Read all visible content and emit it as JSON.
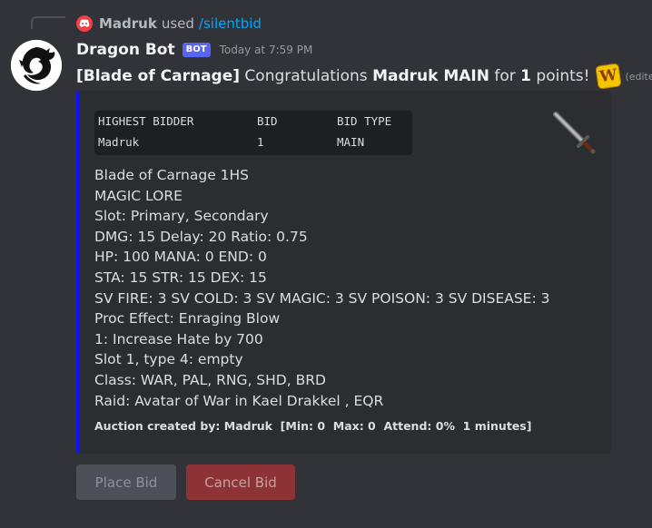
{
  "reply": {
    "username": "Madruk",
    "used_text": "used",
    "command": "/silentbid"
  },
  "message": {
    "bot_name": "Dragon Bot",
    "bot_badge": "BOT",
    "timestamp": "Today at 7:59 PM",
    "item_bracket": "[Blade of Carnage]",
    "congrats_text": "Congratulations",
    "winner": "Madruk MAIN",
    "for_text": "for",
    "points": "1",
    "points_text": "points!",
    "emoji_label": "W",
    "edited": "(edited)"
  },
  "embed": {
    "accent_color": "#1212ff",
    "table": {
      "headers": [
        "HIGHEST BIDDER",
        "BID",
        "BID TYPE"
      ],
      "rows": [
        [
          "Madruk",
          "1",
          "MAIN"
        ]
      ]
    },
    "thumbnail_icon": "sword-icon",
    "details": [
      "Blade of Carnage 1HS",
      "MAGIC LORE",
      "Slot: Primary, Secondary",
      "DMG: 15 Delay: 20 Ratio: 0.75",
      "HP: 100 MANA: 0 END: 0",
      "STA: 15 STR: 15 DEX: 15",
      "SV FIRE: 3 SV COLD: 3 SV MAGIC: 3 SV POISON: 3 SV DISEASE: 3",
      "Proc Effect: Enraging Blow",
      "1: Increase Hate by 700",
      "Slot 1, type 4: empty",
      "Class: WAR, PAL, RNG, SHD, BRD",
      "Raid: Avatar of War in Kael Drakkel , EQR"
    ],
    "footer": "Auction created by: Madruk  [Min: 0  Max: 0  Attend: 0%  1 minutes]"
  },
  "buttons": {
    "place_bid": "Place Bid",
    "cancel_bid": "Cancel Bid"
  }
}
